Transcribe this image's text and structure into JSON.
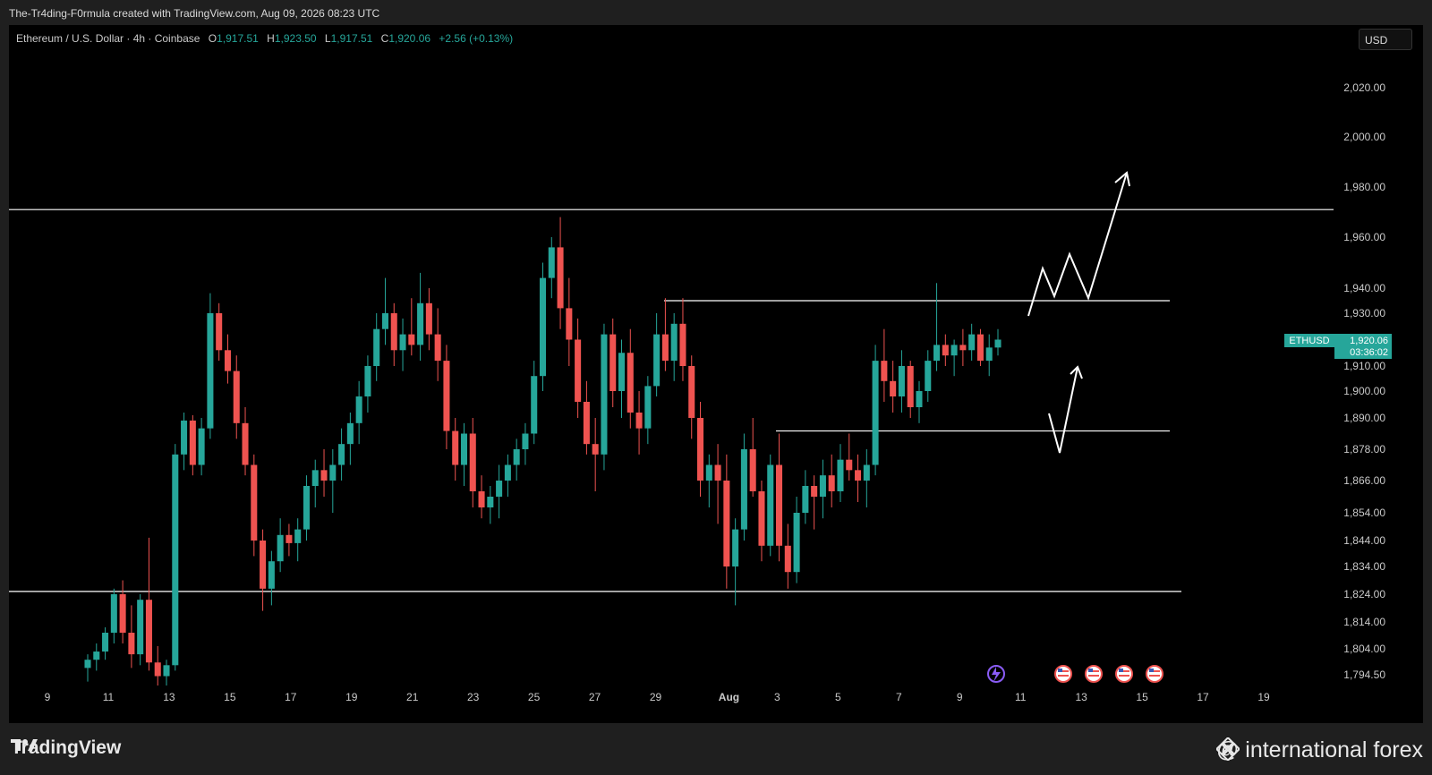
{
  "header": {
    "attribution": "The-Tr4ding-F0rmula created with TradingView.com, Aug 09, 2026 08:23 UTC"
  },
  "symbol": {
    "name": "Ethereum / U.S. Dollar · 4h · Coinbase",
    "open_label": "O",
    "open": "1,917.51",
    "high_label": "H",
    "high": "1,923.50",
    "low_label": "L",
    "low": "1,917.51",
    "close_label": "C",
    "close": "1,920.06",
    "change": "+2.56 (+0.13%)"
  },
  "currency": "USD",
  "price_tag": {
    "ticker": "ETHUSD",
    "price": "1,920.06",
    "countdown": "03:36:02"
  },
  "colors": {
    "up": "#26a69a",
    "down": "#ef5350",
    "background": "#000000",
    "frame": "#1f1f1f",
    "lines": "#ffffff"
  },
  "footer": {
    "logo": "TradingView",
    "watermark": "@ international forex"
  },
  "event_icons": [
    "flash-event-icon",
    "us-flag-icon",
    "us-flag-icon",
    "us-flag-icon",
    "us-flag-icon"
  ],
  "chart_data": {
    "type": "candlestick",
    "y_axis_labels": [
      "2,020.00",
      "2,000.00",
      "1,980.00",
      "1,960.00",
      "1,940.00",
      "1,930.00",
      "1,910.00",
      "1,900.00",
      "1,890.00",
      "1,878.00",
      "1,866.00",
      "1,854.00",
      "1,844.00",
      "1,834.00",
      "1,824.00",
      "1,814.00",
      "1,804.00",
      "1,794.50"
    ],
    "x_axis_labels": [
      "9",
      "11",
      "13",
      "15",
      "17",
      "19",
      "21",
      "23",
      "25",
      "27",
      "29",
      "Aug",
      "3",
      "5",
      "7",
      "9",
      "11",
      "13",
      "15",
      "17",
      "19"
    ],
    "horizontal_levels": [
      1971,
      1935,
      1885,
      1825
    ],
    "ohlc": [
      [
        1797,
        1802,
        1792,
        1800
      ],
      [
        1800,
        1806,
        1796,
        1803
      ],
      [
        1803,
        1812,
        1800,
        1810
      ],
      [
        1810,
        1826,
        1806,
        1824
      ],
      [
        1824,
        1829,
        1806,
        1810
      ],
      [
        1810,
        1820,
        1797,
        1802
      ],
      [
        1802,
        1824,
        1798,
        1822
      ],
      [
        1822,
        1845,
        1796,
        1799
      ],
      [
        1799,
        1805,
        1790,
        1794
      ],
      [
        1794,
        1800,
        1788,
        1798
      ],
      [
        1798,
        1880,
        1796,
        1876
      ],
      [
        1876,
        1892,
        1870,
        1889
      ],
      [
        1889,
        1891,
        1868,
        1872
      ],
      [
        1872,
        1890,
        1868,
        1886
      ],
      [
        1886,
        1938,
        1882,
        1930
      ],
      [
        1930,
        1934,
        1912,
        1916
      ],
      [
        1916,
        1922,
        1903,
        1908
      ],
      [
        1908,
        1914,
        1882,
        1888
      ],
      [
        1888,
        1894,
        1868,
        1872
      ],
      [
        1872,
        1876,
        1838,
        1844
      ],
      [
        1844,
        1848,
        1818,
        1826
      ],
      [
        1826,
        1840,
        1820,
        1836
      ],
      [
        1836,
        1852,
        1832,
        1846
      ],
      [
        1846,
        1850,
        1838,
        1843
      ],
      [
        1843,
        1852,
        1836,
        1848
      ],
      [
        1848,
        1868,
        1844,
        1864
      ],
      [
        1864,
        1874,
        1856,
        1870
      ],
      [
        1870,
        1878,
        1860,
        1866
      ],
      [
        1866,
        1878,
        1854,
        1872
      ],
      [
        1872,
        1886,
        1866,
        1880
      ],
      [
        1880,
        1892,
        1872,
        1888
      ],
      [
        1888,
        1904,
        1880,
        1898
      ],
      [
        1898,
        1914,
        1892,
        1910
      ],
      [
        1910,
        1930,
        1904,
        1924
      ],
      [
        1924,
        1944,
        1918,
        1930
      ],
      [
        1930,
        1934,
        1910,
        1916
      ],
      [
        1916,
        1928,
        1908,
        1922
      ],
      [
        1922,
        1936,
        1914,
        1918
      ],
      [
        1918,
        1946,
        1912,
        1934
      ],
      [
        1934,
        1940,
        1916,
        1922
      ],
      [
        1922,
        1932,
        1904,
        1912
      ],
      [
        1912,
        1918,
        1878,
        1885
      ],
      [
        1885,
        1890,
        1866,
        1872
      ],
      [
        1872,
        1888,
        1864,
        1884
      ],
      [
        1884,
        1890,
        1856,
        1862
      ],
      [
        1862,
        1868,
        1852,
        1856
      ],
      [
        1856,
        1864,
        1850,
        1860
      ],
      [
        1860,
        1872,
        1852,
        1866
      ],
      [
        1866,
        1876,
        1860,
        1872
      ],
      [
        1872,
        1882,
        1866,
        1878
      ],
      [
        1878,
        1888,
        1872,
        1884
      ],
      [
        1884,
        1912,
        1880,
        1906
      ],
      [
        1906,
        1950,
        1900,
        1944
      ],
      [
        1944,
        1960,
        1936,
        1956
      ],
      [
        1956,
        1968,
        1924,
        1932
      ],
      [
        1932,
        1944,
        1910,
        1920
      ],
      [
        1920,
        1928,
        1890,
        1896
      ],
      [
        1896,
        1904,
        1876,
        1880
      ],
      [
        1880,
        1890,
        1862,
        1876
      ],
      [
        1876,
        1926,
        1870,
        1922
      ],
      [
        1922,
        1928,
        1894,
        1900
      ],
      [
        1900,
        1920,
        1890,
        1915
      ],
      [
        1915,
        1924,
        1886,
        1892
      ],
      [
        1892,
        1900,
        1876,
        1886
      ],
      [
        1886,
        1906,
        1880,
        1902
      ],
      [
        1902,
        1930,
        1898,
        1922
      ],
      [
        1922,
        1936,
        1908,
        1912
      ],
      [
        1912,
        1930,
        1904,
        1926
      ],
      [
        1926,
        1936,
        1904,
        1910
      ],
      [
        1910,
        1914,
        1882,
        1890
      ],
      [
        1890,
        1896,
        1860,
        1866
      ],
      [
        1866,
        1876,
        1856,
        1872
      ],
      [
        1872,
        1880,
        1850,
        1866
      ],
      [
        1866,
        1876,
        1826,
        1834
      ],
      [
        1834,
        1852,
        1820,
        1848
      ],
      [
        1848,
        1884,
        1844,
        1878
      ],
      [
        1878,
        1890,
        1860,
        1862
      ],
      [
        1862,
        1866,
        1836,
        1842
      ],
      [
        1842,
        1876,
        1838,
        1872
      ],
      [
        1872,
        1884,
        1836,
        1842
      ],
      [
        1842,
        1850,
        1826,
        1832
      ],
      [
        1832,
        1860,
        1828,
        1854
      ],
      [
        1854,
        1870,
        1850,
        1864
      ],
      [
        1864,
        1868,
        1848,
        1860
      ],
      [
        1860,
        1874,
        1852,
        1868
      ],
      [
        1868,
        1876,
        1856,
        1862
      ],
      [
        1862,
        1880,
        1858,
        1874
      ],
      [
        1874,
        1884,
        1866,
        1870
      ],
      [
        1870,
        1876,
        1858,
        1866
      ],
      [
        1866,
        1878,
        1856,
        1872
      ],
      [
        1872,
        1918,
        1868,
        1912
      ],
      [
        1912,
        1924,
        1896,
        1904
      ],
      [
        1904,
        1912,
        1892,
        1898
      ],
      [
        1898,
        1916,
        1892,
        1910
      ],
      [
        1910,
        1912,
        1890,
        1894
      ],
      [
        1894,
        1904,
        1888,
        1900
      ],
      [
        1900,
        1916,
        1896,
        1912
      ],
      [
        1912,
        1942,
        1908,
        1918
      ],
      [
        1918,
        1922,
        1910,
        1914
      ],
      [
        1914,
        1920,
        1906,
        1918
      ],
      [
        1918,
        1924,
        1910,
        1916
      ],
      [
        1916,
        1926,
        1912,
        1922
      ],
      [
        1922,
        1924,
        1910,
        1912
      ],
      [
        1912,
        1922,
        1906,
        1917
      ],
      [
        1917,
        1924,
        1914,
        1920
      ]
    ]
  }
}
